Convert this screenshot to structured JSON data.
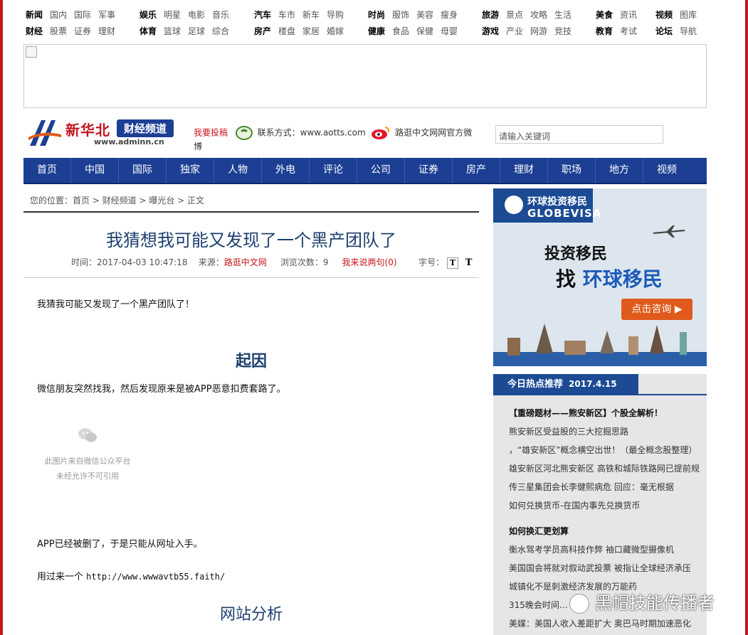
{
  "topnav": {
    "groups": [
      {
        "rows": [
          [
            "新闻",
            "国内",
            "国际",
            "军事"
          ],
          [
            "财经",
            "股票",
            "证券",
            "理财"
          ]
        ]
      },
      {
        "rows": [
          [
            "娱乐",
            "明星",
            "电影",
            "音乐"
          ],
          [
            "体育",
            "篮球",
            "足球",
            "综合"
          ]
        ]
      },
      {
        "rows": [
          [
            "汽车",
            "车市",
            "新车",
            "导购"
          ],
          [
            "房产",
            "楼盘",
            "家居",
            "婚嫁"
          ]
        ]
      },
      {
        "rows": [
          [
            "时尚",
            "服饰",
            "美容",
            "瘦身"
          ],
          [
            "健康",
            "食品",
            "保健",
            "母婴"
          ]
        ]
      },
      {
        "rows": [
          [
            "旅游",
            "景点",
            "攻略",
            "生活"
          ],
          [
            "游戏",
            "产业",
            "网游",
            "竞技"
          ]
        ]
      },
      {
        "rows": [
          [
            "美食",
            "资讯"
          ],
          [
            "教育",
            "考试"
          ]
        ]
      },
      {
        "rows": [
          [
            "视频",
            "图库"
          ],
          [
            "论坛",
            "导航"
          ]
        ]
      }
    ]
  },
  "logo": {
    "brand": "新华北",
    "channel": "财经频道",
    "url": "www.adminn.cn"
  },
  "contact": {
    "submit": "我要投稿",
    "contact_label": "联系方式：www.aotts.com",
    "weibo": "路逛中文网网官方微博"
  },
  "search": {
    "placeholder": "请输入关键词"
  },
  "mainnav": [
    "首页",
    "中国",
    "国际",
    "独家",
    "人物",
    "外电",
    "评论",
    "公司",
    "证券",
    "房产",
    "理财",
    "职场",
    "地方",
    "视频"
  ],
  "breadcrumb": "您的位置：首页 > 财经频道 > 曝光台 > 正文",
  "article": {
    "title": "我猜想我可能又发现了一个黑产团队了",
    "time": "时间：2017-04-03 10:47:18",
    "source_label": "来源：",
    "source": "路逛中文网",
    "views": "浏览次数：9",
    "comment": "我来说两句(0)",
    "fontsize_label": "字号：",
    "font_small": "T",
    "font_large": "T",
    "p1": "我猜我可能又发现了一个黑产团队了！",
    "h_cause": "起因",
    "p2": "微信朋友突然找我，然后发现原来是被APP恶意扣费套路了。",
    "img_note1": "此图片来自微信公众平台",
    "img_note2": "未经允许不可引用",
    "p3": "APP已经被删了，于是只能从网址入手。",
    "p4_prefix": "用过来一个",
    "p4_url": "http://www.wwwavtb55.faith/",
    "h_analysis": "网站分析"
  },
  "promo": {
    "brand_cn": "环球投资移民",
    "brand_en": "GLOBEVISA",
    "line1": "投资移民",
    "line2a": "找",
    "line2b": "环球移民",
    "button": "点击咨询 ▶"
  },
  "hot": {
    "title": "今日热点推荐",
    "date": "2017.4.15",
    "items": [
      "【重磅题材——熊安新区】个股全解析！",
      "熊安新区受益股的三大挖掘思路",
      "，“雄安新区”概念横空出世！（最全概念股整理）",
      "雄安新区河北熊安新区 高铁和城际铁路网已提前规",
      "传三星集团会长李健熙病危 回应：毫无根据",
      "如何兑换货币-在国内事先兑换货币",
      "如何换汇更划算",
      "衡水驾考学员高科技作弊 袖口藏微型摄像机",
      "美国国会将就对叙动武投票 被指让全球经济承压",
      "城镇化不是刺激经济发展的万能药",
      "315晚会时间…",
      "美媒：美国人收入差距扩大 奥巴马时期加速恶化"
    ]
  },
  "watermark": "黑帽技能传播者"
}
